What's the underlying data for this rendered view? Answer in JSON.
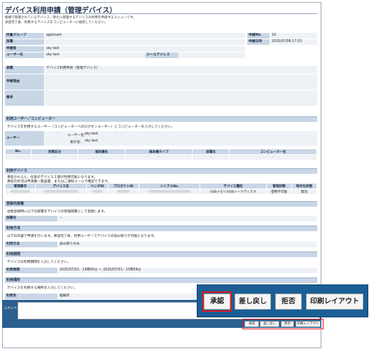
{
  "header": {
    "title": "デバイス利用申請（管理デバイス）",
    "desc1": "組織で管理されているデバイス／新たに管理するデバイスの利用を申請するメニューです。",
    "desc2": "承認完了後、利用するデバイスをコンピューターに接続してください。"
  },
  "info": {
    "group_label": "所属グループ",
    "group_value": "applicant",
    "dept_label": "部署",
    "dept_value": "",
    "applicant_label": "申請者",
    "applicant_value": "sky test",
    "user_label": "ユーザー名",
    "user_value": "sky-test",
    "mail_label": "メールアドレス",
    "mail_value": "",
    "appno_label": "申請No.",
    "appno_value": "19",
    "appdate_label": "申請日時",
    "appdate_value": "2025/07/08 17:53"
  },
  "subject": {
    "subject_label": "表題",
    "subject_value": "デバイス利用申請（管理デバイス）",
    "reason_label": "申請理由",
    "reason_value": "",
    "note_label": "備考",
    "note_value": ""
  },
  "users": {
    "section": "利用ユーザー／コンピューター",
    "desc": "デバイスを利用するユーザー（コンピューターへのログオンユーザー）とコンピューターを入力してください。",
    "user_label": "ユーザー",
    "username_label": "ユーザー名：",
    "username_value": "sky-test",
    "display_label": "表示名：",
    "display_value": "sky test",
    "columns": [
      "No.",
      "状態区分",
      "端末機名",
      "端末機タイプ",
      "部署名",
      "コンピューター名"
    ],
    "row": [
      "-",
      "-",
      "-",
      "-",
      "-",
      "-"
    ]
  },
  "devices": {
    "section": "利用デバイス",
    "desc1": "承認されると、任意のデバイス１個が利用可能になります。",
    "desc2": "承認の状況は申請書一覧画面、またはご通知メールで確認できます。",
    "columns": [
      "管理番号",
      "デバイス名",
      "ベンダID",
      "プロダクトID",
      "シリアルNo",
      "デバイス種別",
      "管理状態",
      "暗号化状態"
    ],
    "row_type": "USBメモリ/USBハードディスク",
    "row_state": "使用不可能",
    "row_enc": "無効"
  },
  "register": {
    "section": "登録先部署",
    "desc": "台帳登録時に以下の部署をデバイスの管理部署として登録します。",
    "dept_label": "部署名",
    "dept_value": "－"
  },
  "method": {
    "section": "利用方法",
    "desc": "以下の内容で申請を行います。承認完了後、利用ユーザーでデバイスの読み取りが可能となります。",
    "label": "利用方法",
    "value": "読み取りのみ"
  },
  "period": {
    "section": "利用期間",
    "desc": "デバイスの利用期間を入力してください。",
    "label": "利用期間",
    "value": "2025/07/01：13時00分 ～ 2025/07/31：23時59分"
  },
  "place": {
    "section": "利用場所",
    "desc": "デバイスを利用する場所を入力してください。",
    "label1": "利用先",
    "value1": "組織内",
    "label2": "詳細（持ち出し先等）",
    "value2": "事務室"
  },
  "comment": {
    "label": "コメント"
  },
  "buttons": {
    "approve": "承認",
    "sendback": "差し戻し",
    "reject": "拒否",
    "print": "印刷レイアウト"
  },
  "colors": {
    "highlight": "#e3171e",
    "popup_bg": "#1b5f96",
    "header_bg": "#c8d6e6"
  }
}
